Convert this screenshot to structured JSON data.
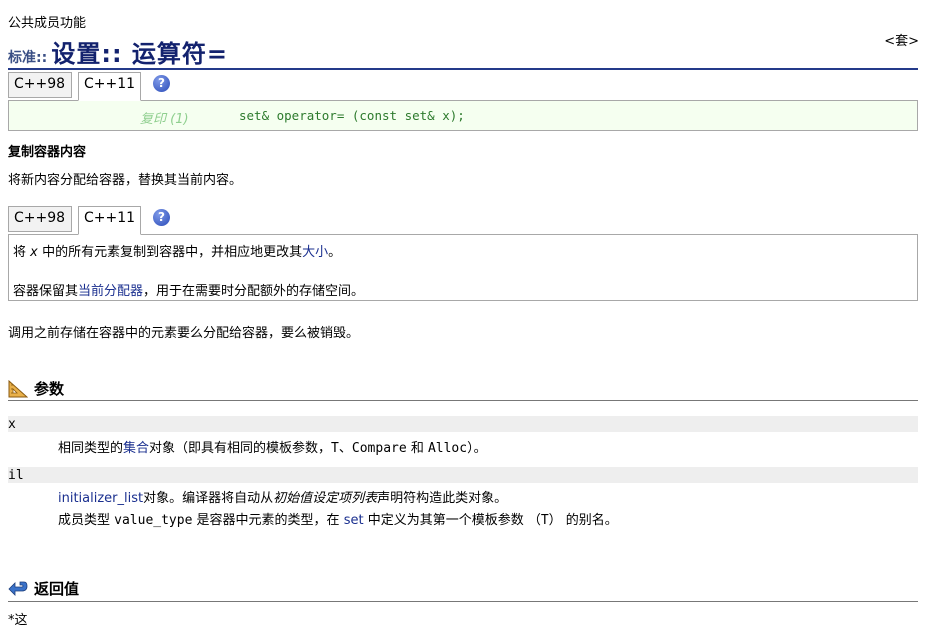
{
  "header": {
    "member_type": "公共成员功能",
    "title_prefix": "标准::",
    "title_main": "设置:: 运算符=",
    "header_link": "<套>"
  },
  "tabs": {
    "cpp98": "C++98",
    "cpp11": "C++11",
    "help": "?"
  },
  "declaration": {
    "label": "复印 (1)",
    "code": "set& operator= (const set& x);"
  },
  "summary": {
    "heading": "复制容器内容",
    "text": "将新内容分配给容器，替换其当前内容。"
  },
  "description": {
    "line1_a": "将",
    "line1_var": "x",
    "line1_b": "中的所有元素复制到容器中，并相应地更改其",
    "line1_link": "大小",
    "line1_c": "。",
    "line2_a": "容器保留其",
    "line2_link": "当前分配器",
    "line2_b": "，用于在需要时分配额外的存储空间。"
  },
  "after_text": "调用之前存储在容器中的元素要么分配给容器，要么被销毁。",
  "parameters": {
    "heading": "参数",
    "items": [
      {
        "name": "x",
        "desc_a": "相同类型的",
        "desc_link": "集合",
        "desc_b": "对象（即具有相同的模板参数，",
        "desc_code1": "T",
        "desc_c": "、",
        "desc_code2": "Compare",
        "desc_d": " 和 ",
        "desc_code3": "Alloc",
        "desc_e": "）。"
      },
      {
        "name": "il",
        "line1_link": "initializer_list",
        "line1_a": "对象。编译器将自动从",
        "line1_italic": "初始值设定项列表",
        "line1_b": "声明符构造此类对象。",
        "line2_a": "成员类型 ",
        "line2_code": "value_type",
        "line2_b": " 是容器中元素的类型，在 ",
        "line2_link": "set",
        "line2_c": " 中定义为其第一个模板参数 （",
        "line2_code2": "T",
        "line2_d": "） 的别名。"
      }
    ]
  },
  "return_value": {
    "heading": "返回值",
    "text": "*这"
  }
}
